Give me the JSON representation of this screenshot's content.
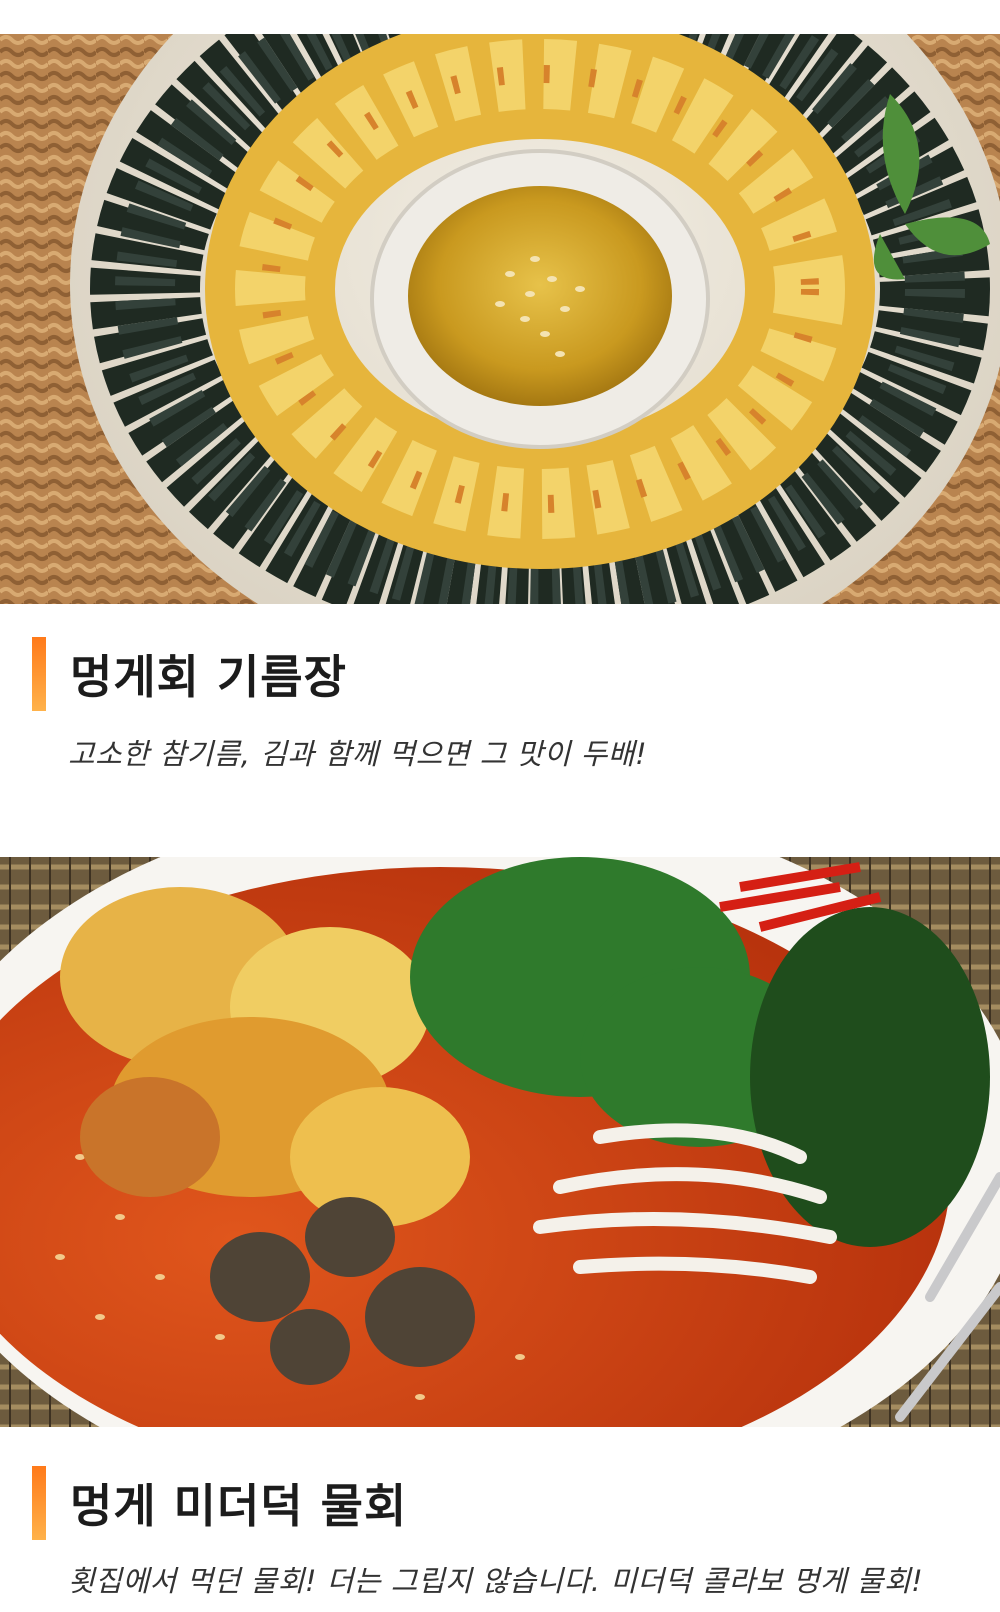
{
  "accent_color": "#ff7a1a",
  "sections": [
    {
      "image": "seasquirt-sesame-oil-dish-photo",
      "title": "멍게회 기름장",
      "subtitle": "고소한 참기름, 김과 함께 먹으면 그 맛이 두배!"
    },
    {
      "image": "seasquirt-mulhoe-cold-soup-photo",
      "title": "멍게 미더덕 물회",
      "subtitle": "횟집에서 먹던 물회! 더는 그립지 않습니다. 미더덕 콜라보 멍게 물회!"
    }
  ]
}
